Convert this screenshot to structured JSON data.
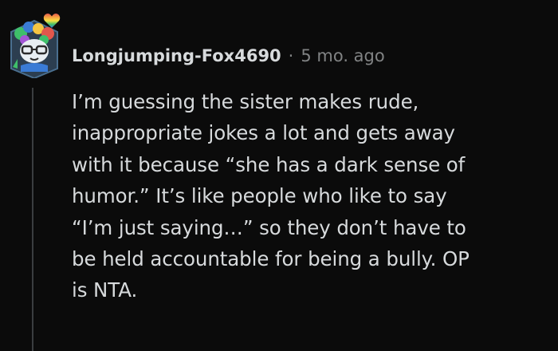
{
  "comment": {
    "username": "Longjumping-Fox4690",
    "separator": "·",
    "timestamp": "5 mo. ago",
    "body_lines": [
      "I’m guessing the sister makes rude,",
      "inappropriate jokes a lot and gets away",
      "with it because “she has a dark sense of",
      "humor.” It’s like people who like to say",
      "“I’m just saying…” so they don’t have to",
      "be held accountable for being a bully. OP",
      "is NTA."
    ]
  },
  "avatar": {
    "icon": "user-avatar-icon",
    "badge_icon": "rainbow-heart-icon",
    "colors": {
      "frame": "#1f3b57",
      "hair_green": "#3fbf6a",
      "hair_blue": "#3a7bd5",
      "face": "#e8eef2",
      "glasses": "#2a2a2a"
    }
  },
  "colors": {
    "background": "#0b0b0b",
    "text_primary": "#d7dadc",
    "text_secondary": "#818384",
    "thread_line": "#3a3d40"
  }
}
